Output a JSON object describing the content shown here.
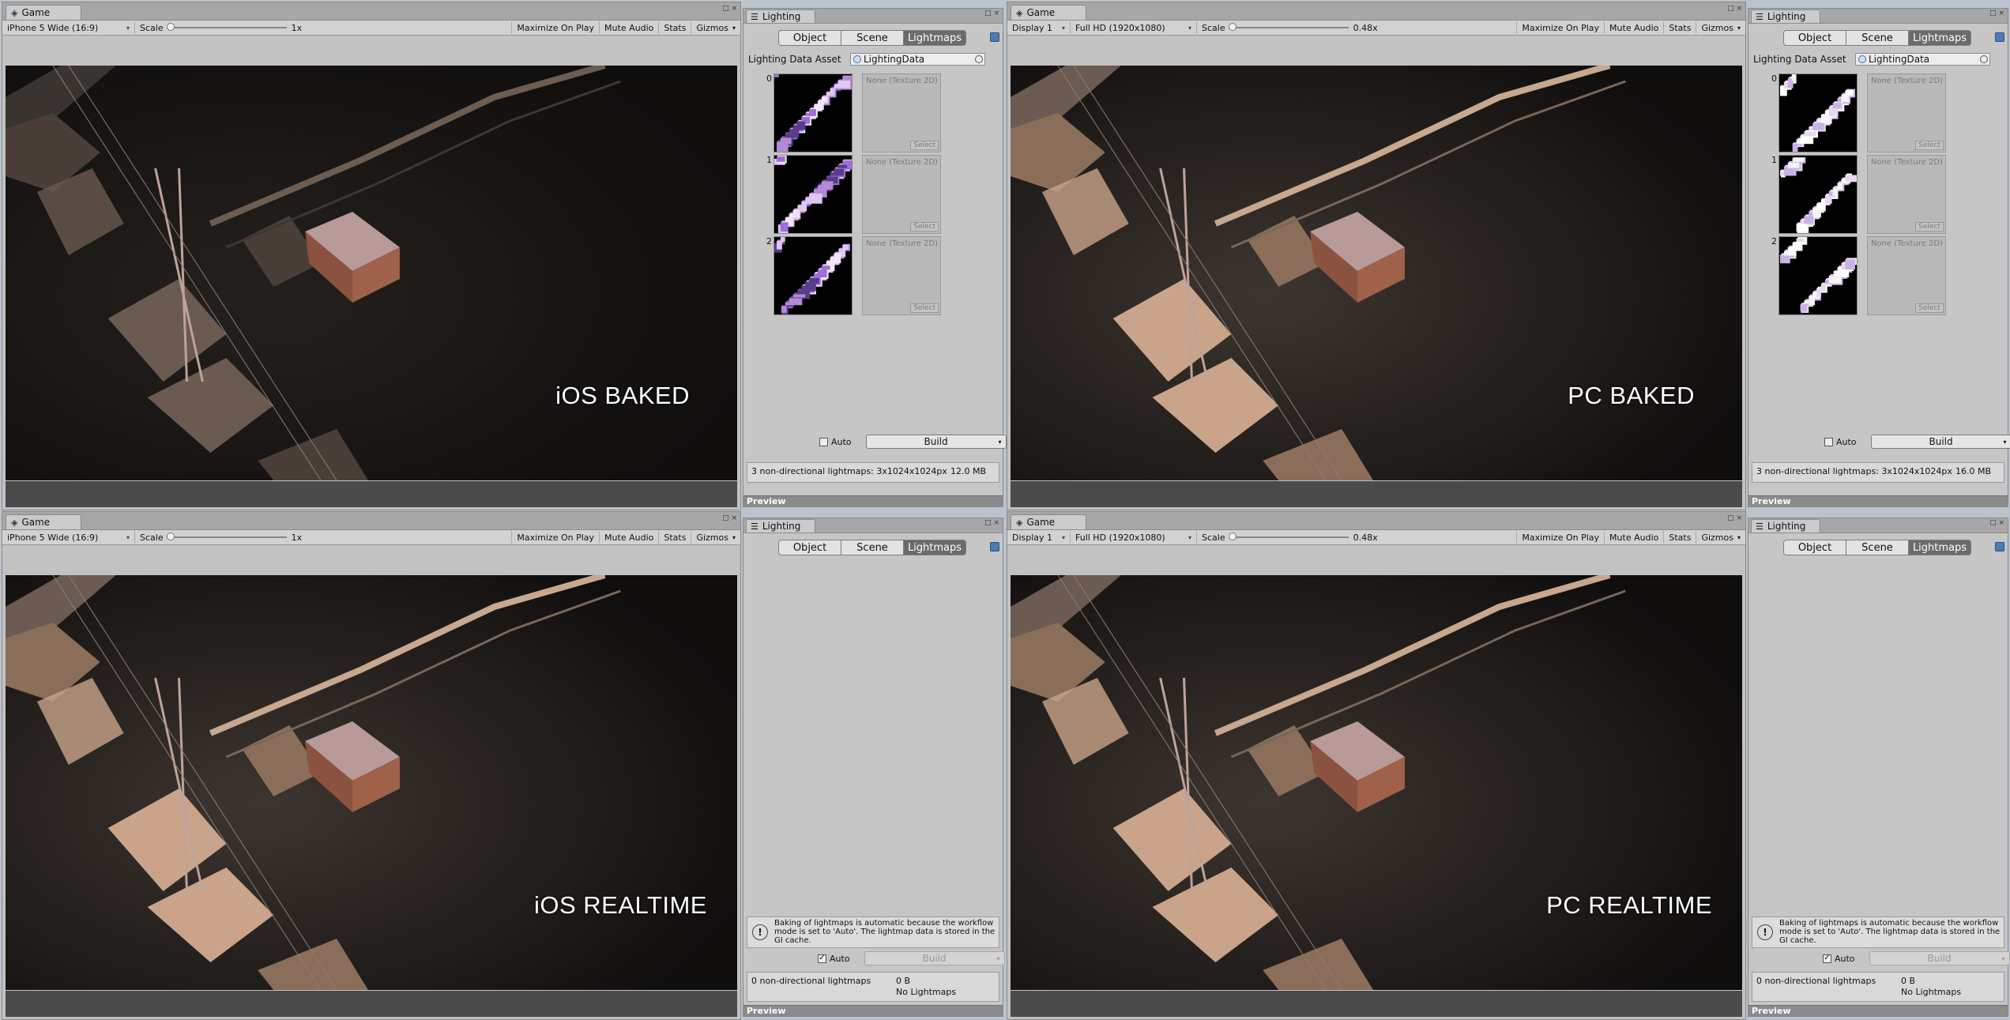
{
  "window_controls": "□ ×",
  "panels": [
    {
      "game": {
        "tab": "Game",
        "resolution": "iPhone 5 Wide (16:9)",
        "scale_label": "Scale",
        "scale_value": "1x",
        "buttons": [
          "Maximize On Play",
          "Mute Audio",
          "Stats",
          "Gizmos"
        ],
        "overlay": "iOS BAKED"
      },
      "lighting": {
        "tab": "Lighting",
        "tabs": [
          "Object",
          "Scene",
          "Lightmaps"
        ],
        "asset_label": "Lighting Data Asset",
        "asset_value": "LightingData",
        "mode": "baked",
        "lightmaps": [
          {
            "index": "0",
            "empty": "None (Texture 2D)",
            "select": "Select"
          },
          {
            "index": "1",
            "empty": "None (Texture 2D)",
            "select": "Select"
          },
          {
            "index": "2",
            "empty": "None (Texture 2D)",
            "select": "Select"
          }
        ],
        "auto_label": "Auto",
        "auto_checked": false,
        "build_label": "Build",
        "summary": "3 non-directional lightmaps: 3x1024x1024px",
        "size": "12.0 MB",
        "preview": "Preview"
      }
    },
    {
      "game": {
        "tab": "Game",
        "display": "Display 1",
        "resolution": "Full HD (1920x1080)",
        "scale_label": "Scale",
        "scale_value": "0.48x",
        "buttons": [
          "Maximize On Play",
          "Mute Audio",
          "Stats",
          "Gizmos"
        ],
        "overlay": "PC BAKED"
      },
      "lighting": {
        "tab": "Lighting",
        "tabs": [
          "Object",
          "Scene",
          "Lightmaps"
        ],
        "asset_label": "Lighting Data Asset",
        "asset_value": "LightingData",
        "mode": "baked",
        "lightmaps": [
          {
            "index": "0",
            "empty": "None (Texture 2D)",
            "select": "Select"
          },
          {
            "index": "1",
            "empty": "None (Texture 2D)",
            "select": "Select"
          },
          {
            "index": "2",
            "empty": "None (Texture 2D)",
            "select": "Select"
          }
        ],
        "auto_label": "Auto",
        "auto_checked": false,
        "build_label": "Build",
        "summary": "3 non-directional lightmaps: 3x1024x1024px",
        "size": "16.0 MB",
        "preview": "Preview"
      }
    },
    {
      "game": {
        "tab": "Game",
        "resolution": "iPhone 5 Wide (16:9)",
        "scale_label": "Scale",
        "scale_value": "1x",
        "buttons": [
          "Maximize On Play",
          "Mute Audio",
          "Stats",
          "Gizmos"
        ],
        "overlay": "iOS REALTIME"
      },
      "lighting": {
        "tab": "Lighting",
        "tabs": [
          "Object",
          "Scene",
          "Lightmaps"
        ],
        "mode": "realtime",
        "warning": "Baking of lightmaps is automatic because the workflow mode is set to 'Auto'. The lightmap data is stored in the GI cache.",
        "auto_label": "Auto",
        "auto_checked": true,
        "build_label": "Build",
        "summary": "0 non-directional lightmaps",
        "size": "0 B",
        "no_lightmaps": "No Lightmaps",
        "preview": "Preview"
      }
    },
    {
      "game": {
        "tab": "Game",
        "display": "Display 1",
        "resolution": "Full HD (1920x1080)",
        "scale_label": "Scale",
        "scale_value": "0.48x",
        "buttons": [
          "Maximize On Play",
          "Mute Audio",
          "Stats",
          "Gizmos"
        ],
        "overlay": "PC REALTIME"
      },
      "lighting": {
        "tab": "Lighting",
        "tabs": [
          "Object",
          "Scene",
          "Lightmaps"
        ],
        "mode": "realtime",
        "warning": "Baking of lightmaps is automatic because the workflow mode is set to 'Auto'. The lightmap data is stored in the GI cache.",
        "auto_label": "Auto",
        "auto_checked": true,
        "build_label": "Build",
        "summary": "0 non-directional lightmaps",
        "size": "0 B",
        "no_lightmaps": "No Lightmaps",
        "preview": "Preview"
      }
    }
  ]
}
